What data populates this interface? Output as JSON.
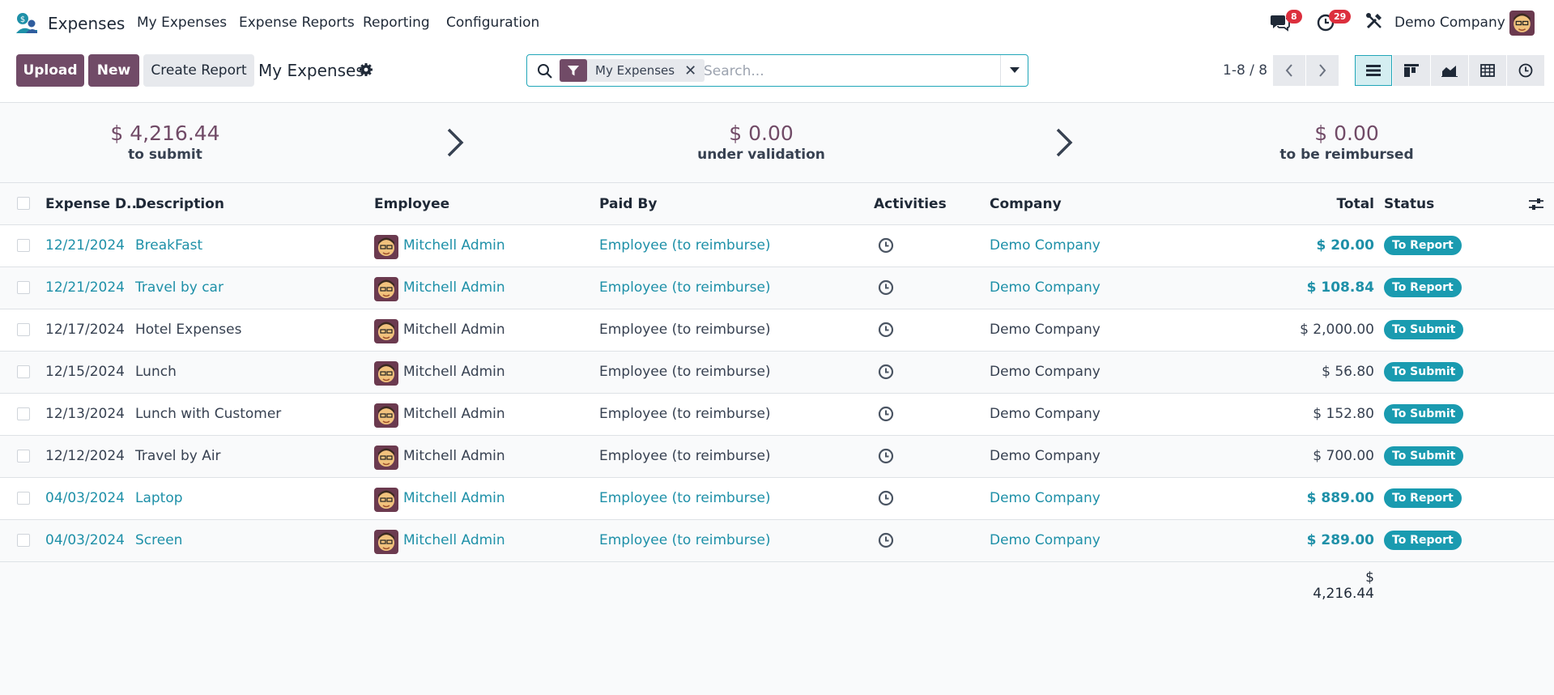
{
  "app": {
    "name": "Expenses"
  },
  "nav": {
    "items": [
      "My Expenses",
      "Expense Reports",
      "Reporting",
      "Configuration"
    ],
    "messages_count": "8",
    "activities_count": "29",
    "company": "Demo Company"
  },
  "control": {
    "upload_label": "Upload",
    "new_label": "New",
    "create_report_label": "Create Report",
    "title": "My Expenses",
    "facet_label": "My Expenses",
    "search_placeholder": "Search...",
    "pager": "1-8 / 8"
  },
  "summary": [
    {
      "amount": "$ 4,216.44",
      "label": "to submit"
    },
    {
      "amount": "$ 0.00",
      "label": "under validation"
    },
    {
      "amount": "$ 0.00",
      "label": "to be reimbursed"
    }
  ],
  "table": {
    "headers": {
      "date": "Expense D...",
      "description": "Description",
      "employee": "Employee",
      "paid_by": "Paid By",
      "activities": "Activities",
      "company": "Company",
      "total": "Total",
      "status": "Status"
    },
    "rows": [
      {
        "date": "12/21/2024",
        "description": "BreakFast",
        "employee": "Mitchell Admin",
        "paid_by": "Employee (to reimburse)",
        "company": "Demo Company",
        "total": "$ 20.00",
        "status": "To Report",
        "highlight": true
      },
      {
        "date": "12/21/2024",
        "description": "Travel by car",
        "employee": "Mitchell Admin",
        "paid_by": "Employee (to reimburse)",
        "company": "Demo Company",
        "total": "$ 108.84",
        "status": "To Report",
        "highlight": true
      },
      {
        "date": "12/17/2024",
        "description": "Hotel Expenses",
        "employee": "Mitchell Admin",
        "paid_by": "Employee (to reimburse)",
        "company": "Demo Company",
        "total": "$ 2,000.00",
        "status": "To Submit",
        "highlight": false
      },
      {
        "date": "12/15/2024",
        "description": "Lunch",
        "employee": "Mitchell Admin",
        "paid_by": "Employee (to reimburse)",
        "company": "Demo Company",
        "total": "$ 56.80",
        "status": "To Submit",
        "highlight": false
      },
      {
        "date": "12/13/2024",
        "description": "Lunch with Customer",
        "employee": "Mitchell Admin",
        "paid_by": "Employee (to reimburse)",
        "company": "Demo Company",
        "total": "$ 152.80",
        "status": "To Submit",
        "highlight": false
      },
      {
        "date": "12/12/2024",
        "description": "Travel by Air",
        "employee": "Mitchell Admin",
        "paid_by": "Employee (to reimburse)",
        "company": "Demo Company",
        "total": "$ 700.00",
        "status": "To Submit",
        "highlight": false
      },
      {
        "date": "04/03/2024",
        "description": "Laptop",
        "employee": "Mitchell Admin",
        "paid_by": "Employee (to reimburse)",
        "company": "Demo Company",
        "total": "$ 889.00",
        "status": "To Report",
        "highlight": true
      },
      {
        "date": "04/03/2024",
        "description": "Screen",
        "employee": "Mitchell Admin",
        "paid_by": "Employee (to reimburse)",
        "company": "Demo Company",
        "total": "$ 289.00",
        "status": "To Report",
        "highlight": true
      }
    ],
    "footer_total": "$ 4,216.44"
  },
  "colors": {
    "brand": "#714b67",
    "link": "#1e90a8",
    "badge": "#1a9bb0",
    "notify": "#dc2f3d"
  }
}
